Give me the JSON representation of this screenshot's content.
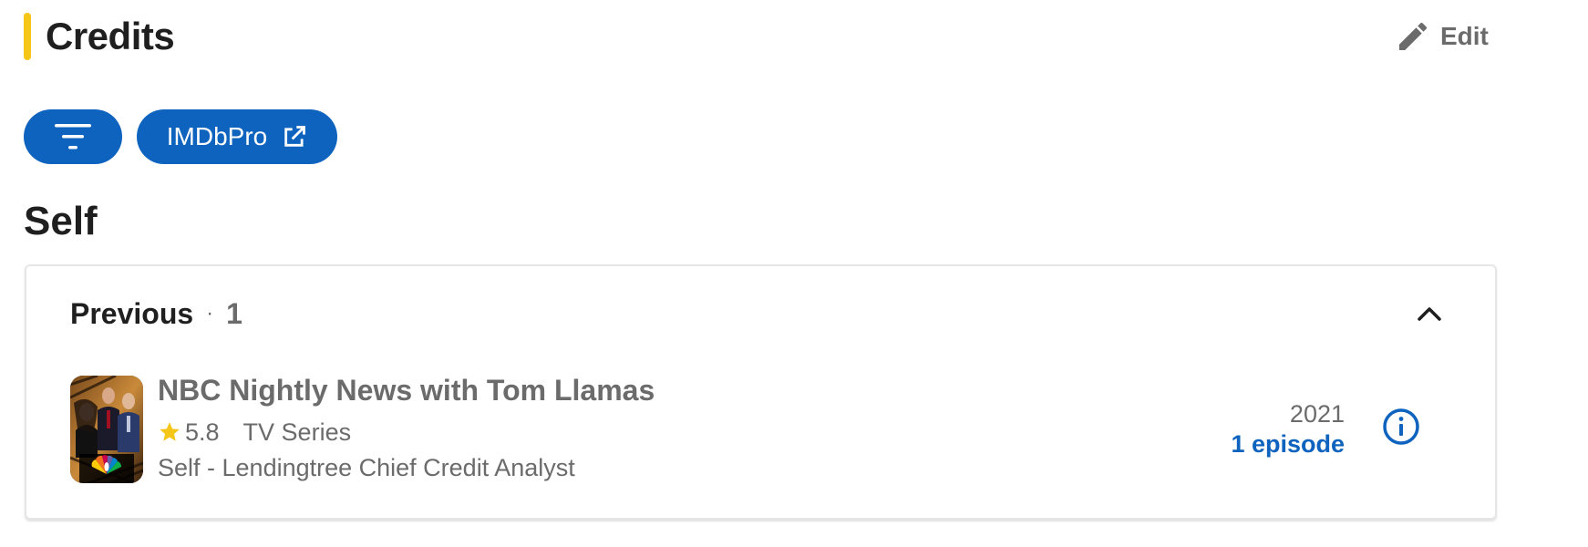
{
  "header": {
    "title": "Credits",
    "edit_label": "Edit"
  },
  "filters": {
    "imdbpro_label": "IMDbPro"
  },
  "section": {
    "heading": "Self",
    "group": {
      "title": "Previous",
      "separator": "·",
      "count": "1",
      "items": [
        {
          "title": "NBC Nightly News with Tom Llamas",
          "rating": "5.8",
          "type": "TV Series",
          "role": "Self - Lendingtree Chief Credit Analyst",
          "year": "2021",
          "episodes": "1 episode"
        }
      ]
    }
  },
  "colors": {
    "accent": "#f5c518",
    "primary_blue": "#0e63be",
    "muted_text": "#6b6b6b",
    "star": "#f5c518"
  },
  "icons": {
    "edit": "pencil-icon",
    "filter": "filter-icon",
    "external": "external-link-icon",
    "collapse": "chevron-up-icon",
    "rating": "star-icon",
    "info": "info-icon"
  }
}
